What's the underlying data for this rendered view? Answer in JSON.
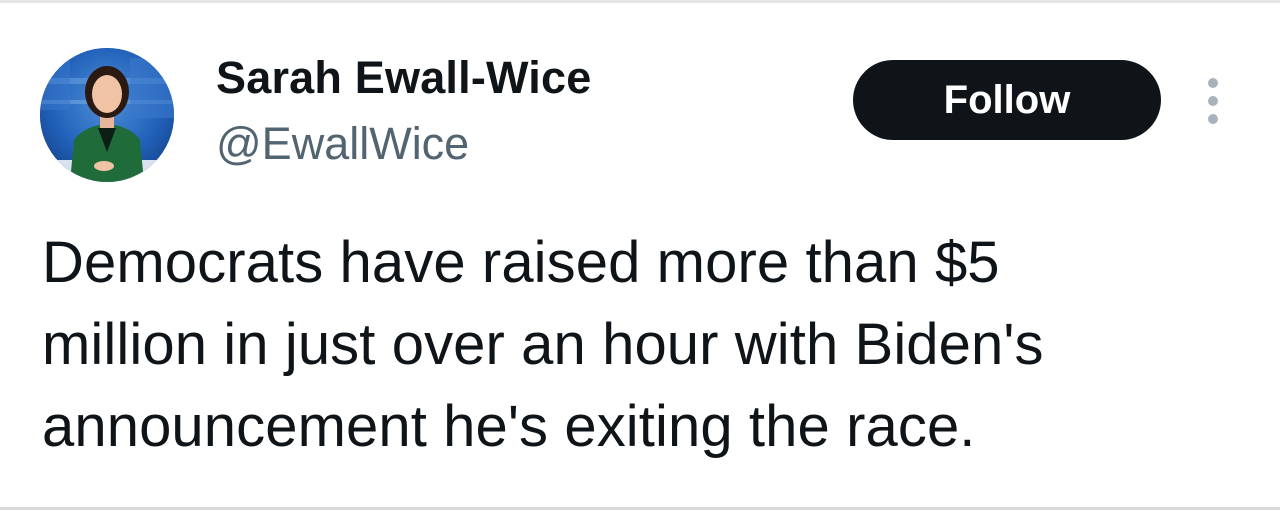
{
  "author": {
    "display_name": "Sarah Ewall-Wice",
    "handle": "@EwallWice",
    "avatar_icon": "avatar-photo"
  },
  "actions": {
    "follow_label": "Follow",
    "more_icon": "more-vertical-icon"
  },
  "tweet": {
    "lines": [
      "Democrats have raised more than $5",
      "million in just over an hour with Biden's",
      "announcement he's exiting the race."
    ]
  },
  "colors": {
    "text_primary": "#0f1419",
    "text_secondary": "#536471",
    "button_bg": "#0f1419",
    "button_text": "#ffffff",
    "icon_muted": "#a8b3bd"
  }
}
